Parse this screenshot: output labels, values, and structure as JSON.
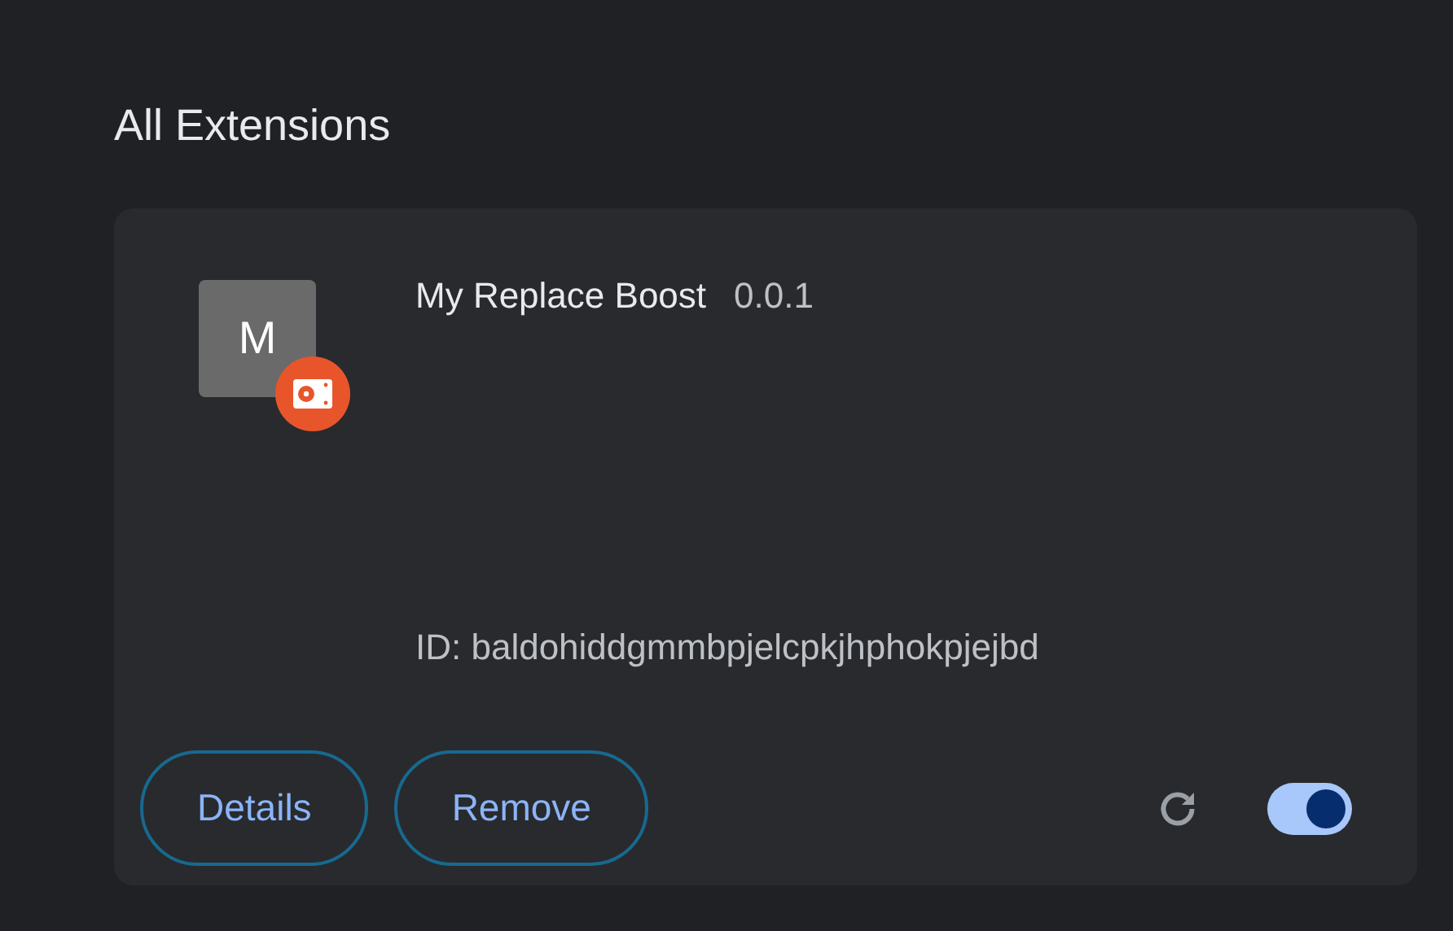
{
  "heading": "All Extensions",
  "extension": {
    "icon_letter": "M",
    "name": "My Replace Boost",
    "version": "0.0.1",
    "id": "ID: baldohiddgmmbpjelcpkjhphokpjejbd",
    "enabled": true
  },
  "buttons": [
    "Details",
    "Remove"
  ]
}
